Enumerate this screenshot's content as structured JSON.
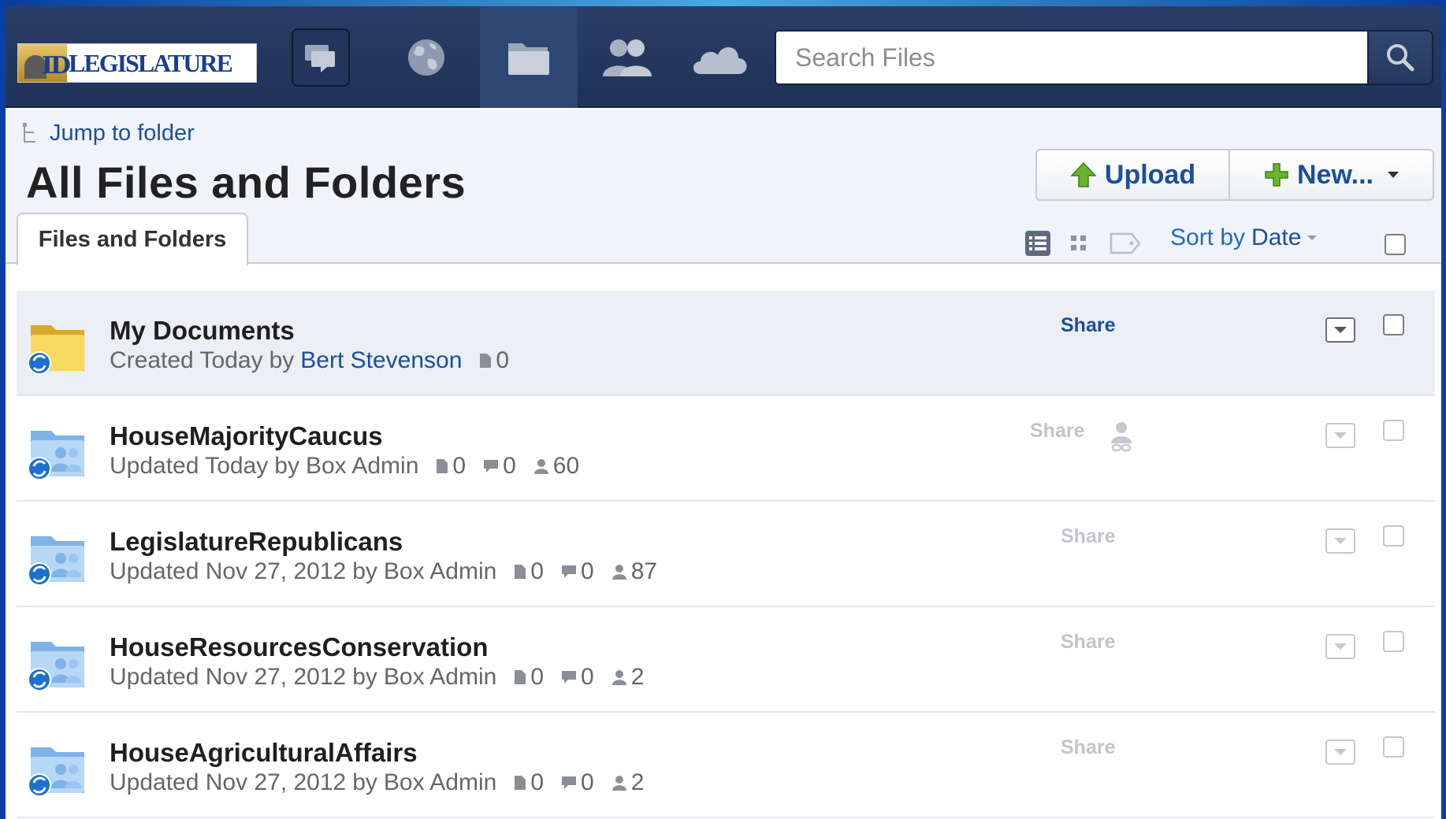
{
  "header": {
    "logo_text": "LEGISLATURE",
    "logo_mark": "ID",
    "nav": [
      {
        "icon": "chat-bubbles-icon"
      },
      {
        "icon": "globe-icon"
      },
      {
        "icon": "folder-icon",
        "active": true
      },
      {
        "icon": "users-icon"
      },
      {
        "icon": "cloud-icon"
      }
    ],
    "search_placeholder": "Search Files",
    "search_icon": "magnifier-icon"
  },
  "subheader": {
    "jump_label": "Jump to folder",
    "title": "All Files and Folders",
    "upload_label": "Upload",
    "new_label": "New...",
    "tab_label": "Files and Folders",
    "sort_label": "Sort by",
    "sort_value": "Date"
  },
  "colors": {
    "header_bg": "#23375e",
    "link": "#1b4f9b",
    "subheader_bg": "#f0f3f8"
  },
  "rows": [
    {
      "name": "My Documents",
      "status": "Created Today",
      "by": "by",
      "user": "Bert Stevenson",
      "files": "0",
      "share": "Share",
      "type": "personal-folder",
      "highlight": true
    },
    {
      "name": "HouseMajorityCaucus",
      "status": "Updated Today",
      "by": "by",
      "user": "Box Admin",
      "files": "0",
      "comments": "0",
      "collaborators": "60",
      "share": "Share",
      "type": "shared-folder",
      "share_user_icon": true
    },
    {
      "name": "LegislatureRepublicans",
      "status": "Updated Nov 27, 2012",
      "by": "by",
      "user": "Box Admin",
      "files": "0",
      "comments": "0",
      "collaborators": "87",
      "share": "Share",
      "type": "shared-folder"
    },
    {
      "name": "HouseResourcesConservation",
      "status": "Updated Nov 27, 2012",
      "by": "by",
      "user": "Box Admin",
      "files": "0",
      "comments": "0",
      "collaborators": "2",
      "share": "Share",
      "type": "shared-folder"
    },
    {
      "name": "HouseAgriculturalAffairs",
      "status": "Updated Nov 27, 2012",
      "by": "by",
      "user": "Box Admin",
      "files": "0",
      "comments": "0",
      "collaborators": "2",
      "share": "Share",
      "type": "shared-folder"
    }
  ]
}
